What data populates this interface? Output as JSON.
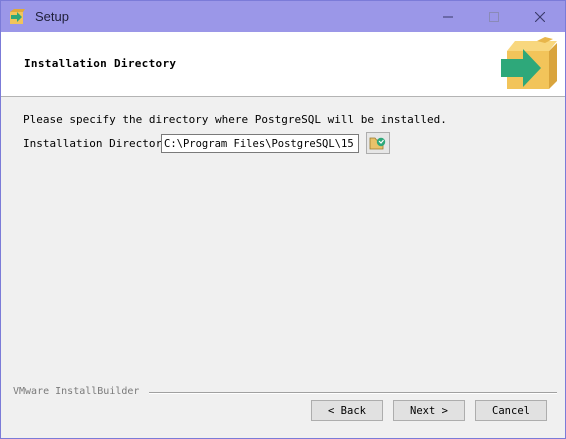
{
  "window": {
    "title": "Setup",
    "icon": "setup-arrow-icon",
    "controls": {
      "minimize": "minimize-icon",
      "maximize": "maximize-icon",
      "close": "close-icon"
    }
  },
  "header": {
    "title": "Installation Directory",
    "logo": "installbuilder-box-arrow-icon"
  },
  "content": {
    "prompt": "Please specify the directory where PostgreSQL will be installed.",
    "dir_label": "Installation Directory",
    "dir_value": "C:\\Program Files\\PostgreSQL\\15",
    "browse_icon": "folder-browse-icon"
  },
  "footer": {
    "brand": "VMware InstallBuilder",
    "back_label": "< Back",
    "next_label": "Next >",
    "cancel_label": "Cancel"
  },
  "colors": {
    "titlebar": "#9b97e8",
    "header_bg": "#ffffff",
    "body_bg": "#f0f0f0",
    "logo_box": "#f2c45a",
    "logo_arrow": "#2ea87a"
  }
}
